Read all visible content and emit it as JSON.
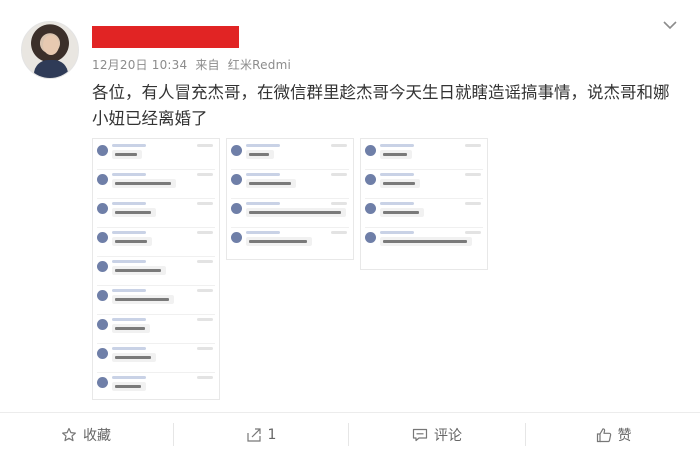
{
  "post": {
    "timestamp": "12月20日 10:34",
    "source_prefix": "来自",
    "source_device": "红米Redmi",
    "text": "各位，有人冒充杰哥，在微信群里趁杰哥今天生日就瞎造谣搞事情，说杰哥和娜小妞已经离婚了"
  },
  "actions": {
    "favorite_label": "收藏",
    "repost_count": "1",
    "comment_label": "评论",
    "like_label": "赞"
  },
  "icons": {
    "menu": "chevron-down-icon",
    "favorite": "star-icon",
    "repost": "share-icon",
    "comment": "comment-icon",
    "like": "thumbs-up-icon"
  },
  "colors": {
    "redaction": "#e12424",
    "meta_text": "#8c8c8c",
    "action_text": "#666666"
  }
}
